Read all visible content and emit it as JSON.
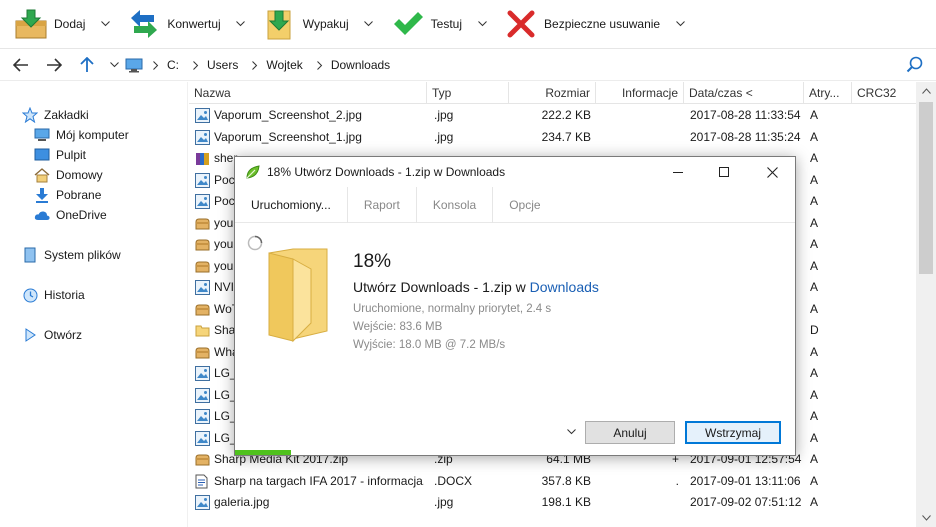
{
  "toolbar": {
    "buttons": [
      {
        "label": "Dodaj",
        "icon": "add-archive-icon"
      },
      {
        "label": "Konwertuj",
        "icon": "convert-arrows-icon"
      },
      {
        "label": "Wypakuj",
        "icon": "extract-folder-icon"
      },
      {
        "label": "Testuj",
        "icon": "checkmark-icon"
      },
      {
        "label": "Bezpieczne usuwanie",
        "icon": "red-x-icon"
      }
    ]
  },
  "address": {
    "crumbs": [
      "C:",
      "Users",
      "Wojtek",
      "Downloads"
    ]
  },
  "sidebar": {
    "items": [
      {
        "label": "Zakładki",
        "icon": "star-icon"
      },
      {
        "label": "Mój komputer",
        "icon": "computer-icon"
      },
      {
        "label": "Pulpit",
        "icon": "desktop-icon"
      },
      {
        "label": "Domowy",
        "icon": "home-icon"
      },
      {
        "label": "Pobrane",
        "icon": "download-icon"
      },
      {
        "label": "OneDrive",
        "icon": "cloud-icon"
      },
      {
        "label": "System plików",
        "icon": "drive-icon"
      },
      {
        "label": "Historia",
        "icon": "history-icon"
      },
      {
        "label": "Otwórz",
        "icon": "play-icon"
      }
    ]
  },
  "columns": {
    "name": "Nazwa",
    "type": "Typ",
    "size": "Rozmiar",
    "info": "Informacje",
    "date": "Data/czas <",
    "attr": "Atry...",
    "crc": "CRC32"
  },
  "rows": [
    {
      "name": "Vaporum_Screenshot_2.jpg",
      "type": ".jpg",
      "size": "222.2 KB",
      "info": "",
      "date": "2017-08-28 11:33:54",
      "attr": "A",
      "icon": "image"
    },
    {
      "name": "Vaporum_Screenshot_1.jpg",
      "type": ".jpg",
      "size": "234.7 KB",
      "info": "",
      "date": "2017-08-28 11:35:24",
      "attr": "A",
      "icon": "image"
    },
    {
      "name": "sher",
      "type": "",
      "size": "",
      "info": "",
      "date": "",
      "attr": "A",
      "icon": "rar"
    },
    {
      "name": "Poc",
      "type": "",
      "size": "",
      "info": "",
      "date": "",
      "attr": "A",
      "icon": "image"
    },
    {
      "name": "Poc",
      "type": "",
      "size": "",
      "info": "",
      "date": "",
      "attr": "A",
      "icon": "image"
    },
    {
      "name": "you",
      "type": "",
      "size": "",
      "info": "",
      "date": "",
      "attr": "A",
      "icon": "archive"
    },
    {
      "name": "you",
      "type": "",
      "size": "",
      "info": "",
      "date": "",
      "attr": "A",
      "icon": "archive"
    },
    {
      "name": "you",
      "type": "",
      "size": "",
      "info": "",
      "date": "",
      "attr": "A",
      "icon": "archive"
    },
    {
      "name": "NVI",
      "type": "",
      "size": "",
      "info": "",
      "date": "",
      "attr": "A",
      "icon": "image"
    },
    {
      "name": "WoT",
      "type": "",
      "size": "",
      "info": "",
      "date": "",
      "attr": "A",
      "icon": "archive"
    },
    {
      "name": "Shar",
      "type": "",
      "size": "",
      "info": "",
      "date": "",
      "attr": "D",
      "icon": "folder"
    },
    {
      "name": "Wha",
      "type": "",
      "size": "",
      "info": "",
      "date": "",
      "attr": "A",
      "icon": "archive"
    },
    {
      "name": "LG_",
      "type": "",
      "size": "",
      "info": "",
      "date": "",
      "attr": "A",
      "icon": "image"
    },
    {
      "name": "LG_",
      "type": "",
      "size": "",
      "info": "",
      "date": "",
      "attr": "A",
      "icon": "image"
    },
    {
      "name": "LG_",
      "type": "",
      "size": "",
      "info": "",
      "date": "",
      "attr": "A",
      "icon": "image"
    },
    {
      "name": "LG_",
      "type": "",
      "size": "",
      "info": "",
      "date": "",
      "attr": "A",
      "icon": "image"
    },
    {
      "name": "Sharp Media Kit 2017.zip",
      "type": ".zip",
      "size": "64.1 MB",
      "info": "+",
      "date": "2017-09-01 12:57:54",
      "attr": "A",
      "icon": "archive"
    },
    {
      "name": "Sharp na targach IFA 2017 - informacja...",
      "type": ".DOCX",
      "size": "357.8 KB",
      "info": ".",
      "date": "2017-09-01 13:11:06",
      "attr": "A",
      "icon": "doc"
    },
    {
      "name": "galeria.jpg",
      "type": ".jpg",
      "size": "198.1 KB",
      "info": "",
      "date": "2017-09-02 07:51:12",
      "attr": "A",
      "icon": "image"
    }
  ],
  "dialog": {
    "title": "18% Utwórz Downloads - 1.zip w Downloads",
    "tabs": [
      "Uruchomiony...",
      "Raport",
      "Konsola",
      "Opcje"
    ],
    "percent": "18%",
    "progress": 0.18,
    "op_prefix": "Utwórz Downloads - 1.zip w ",
    "op_link": "Downloads",
    "status": "Uruchomione, normalny priorytet, 2.4 s",
    "input": "Wejście: 83.6 MB",
    "output": "Wyjście: 18.0 MB @ 7.2 MB/s",
    "cancel": "Anuluj",
    "pause": "Wstrzymaj"
  }
}
